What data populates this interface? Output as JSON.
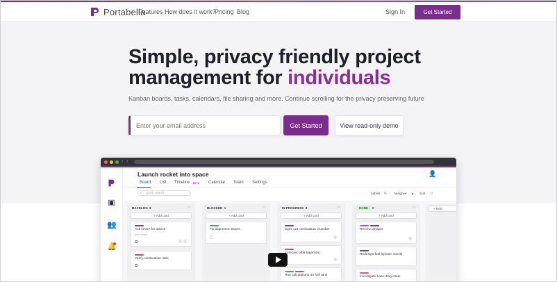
{
  "nav": {
    "brand": "Portabella",
    "links": [
      "Features",
      "How does it work?",
      "Pricing",
      "Blog"
    ],
    "signin": "Sign In",
    "cta": "Get Started"
  },
  "hero": {
    "title_line1": "Simple, privacy friendly project",
    "title_line2": "management for ",
    "title_accent": "individuals",
    "subtitle": "Kanban boards, tasks, calendars, file sharing and more. Continue scrolling for the privacy preserving future",
    "email_placeholder": "Enter your email address",
    "cta": "Get Started",
    "demo": "View read-only demo"
  },
  "app": {
    "project_title": "Launch rocket into space",
    "tabs": [
      "Board",
      "List",
      "Timeline",
      "Calendar",
      "Team",
      "Settings"
    ],
    "beta": "BETA",
    "search_placeholder": "Quick search",
    "toolbar": [
      "Labels",
      "Assignee",
      "Sort"
    ],
    "columns": [
      {
        "name": "BACKLOG",
        "count": "8",
        "add": "+ Add card",
        "cards": [
          {
            "title": "Ask NASA for advice",
            "sub": "satchutlati...",
            "tags": [
              "#6a3fb8"
            ]
          },
          {
            "title": "Verify combustion ratio",
            "tags": [
              "#e0446a"
            ]
          }
        ]
      },
      {
        "name": "BLOCKED",
        "count": "1",
        "add": "+ Add card",
        "cards": [
          {
            "title": "Fix alignment issues",
            "tags": [
              "#3fae5a"
            ]
          }
        ]
      },
      {
        "name": "IN PROGRESS",
        "count": "8",
        "add": "+ Add card",
        "cards": [
          {
            "title": "Spec out combustion chamber",
            "tags": [
              "#6a3fb8"
            ]
          },
          {
            "title": "Forecast orbit trajectory",
            "tags": [
              "#e0446a"
            ]
          },
          {
            "title": "Run calculations on fuel tank",
            "tags": [
              "#3fae5a",
              "#e0446a"
            ]
          }
        ]
      },
      {
        "name": "DONE",
        "count": "3",
        "add": "+ Add card",
        "cards": [
          {
            "title": "Review designs",
            "tags": [
              "#d94fb0",
              "#6a3fb8"
            ]
          },
          {
            "title": "Redesign fuel injector nozzle",
            "tags": [
              "#6a3fb8"
            ]
          },
          {
            "title": "Investigate base drag issue",
            "tags": [
              "#d94fb0"
            ]
          }
        ]
      }
    ],
    "next_column": "+ New"
  },
  "colors": {
    "brand": "#7b2d8e",
    "accent_text": "#8a2f96",
    "link_blue": "#2a4fa8"
  }
}
